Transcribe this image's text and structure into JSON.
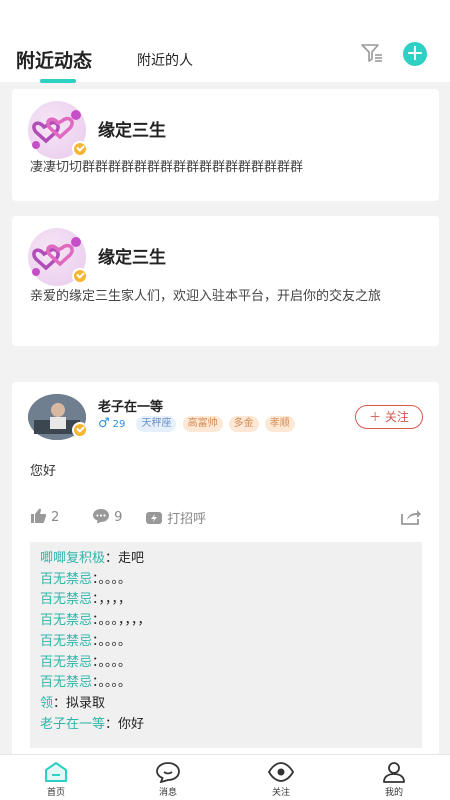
{
  "header": {
    "tab_active": "附近动态",
    "tab_inactive": "附近的人"
  },
  "group_cards": [
    {
      "name": "缘定三生",
      "desc": "凄凄切切群群群群群群群群群群群群群群群群群"
    },
    {
      "name": "缘定三生",
      "desc": "亲爱的缘定三生家人们，欢迎入驻本平台，开启你的交友之旅"
    }
  ],
  "post": {
    "user_name": "老子在一等",
    "age": "29",
    "tags": [
      "天秤座",
      "高富帅",
      "多金",
      "孝顺"
    ],
    "follow_label": "关注",
    "text": "您好",
    "likes": "2",
    "comments_count": "9",
    "greet_label": "打招呼",
    "comments": [
      {
        "author": "唧唧复积极",
        "text": "走吧"
      },
      {
        "author": "百无禁忌",
        "text": "。。。。"
      },
      {
        "author": "百无禁忌",
        "text": "，，，，"
      },
      {
        "author": "百无禁忌",
        "text": "。。。，，，，"
      },
      {
        "author": "百无禁忌",
        "text": "。。。。"
      },
      {
        "author": "百无禁忌",
        "text": "。。。。"
      },
      {
        "author": "百无禁忌",
        "text": "。。。。"
      },
      {
        "author": "领",
        "text": "拟录取"
      },
      {
        "author": "老子在一等",
        "text": "你好"
      }
    ]
  },
  "nav": {
    "home": "首页",
    "messages": "消息",
    "follow": "关注",
    "mine": "我的"
  },
  "colors": {
    "accent": "#2fd0c4",
    "follow": "#d65a4e",
    "comment_author": "#2fb5a8"
  }
}
